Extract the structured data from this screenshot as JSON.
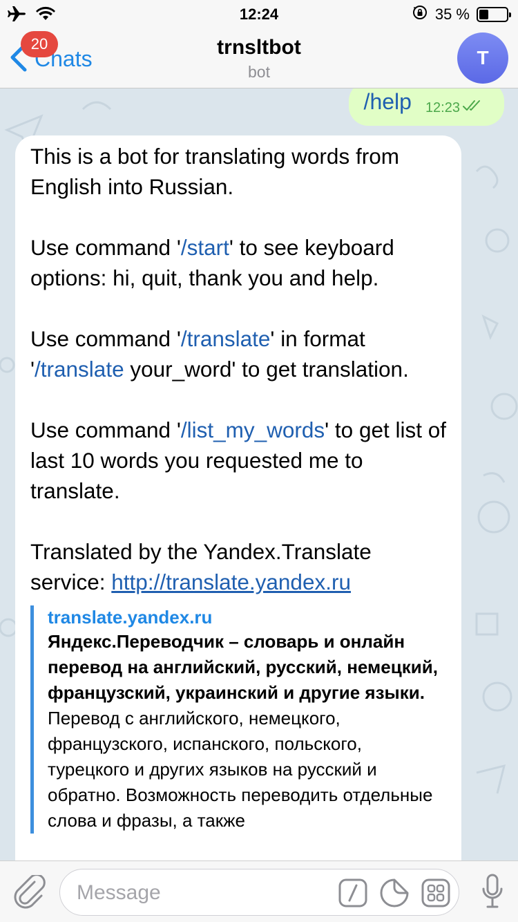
{
  "status_bar": {
    "time": "12:24",
    "battery_percent": "35 %",
    "battery_level": 0.35,
    "icons": [
      "airplane-icon",
      "wifi-icon",
      "rotation-lock-icon",
      "battery-icon"
    ]
  },
  "nav": {
    "back_label": "Chats",
    "unread_badge": "20",
    "title": "trnsltbot",
    "subtitle": "bot",
    "avatar_letter": "T"
  },
  "outgoing": {
    "text": "/help",
    "time": "12:23"
  },
  "incoming": {
    "p1": "This is a bot for translating words from English into Russian.",
    "p2_pre": "Use command '",
    "p2_cmd": "/start",
    "p2_post": "' to see keyboard options: hi, quit, thank you and help.",
    "p3_pre": "Use command '",
    "p3_cmd": "/translate",
    "p3_mid": "' in format '",
    "p3_cmd2": "/translate",
    "p3_post": " your_word' to get translation.",
    "p4_pre": "Use command '",
    "p4_cmd": "/list_my_words",
    "p4_post": "' to get list of last 10 words you requested me to translate.",
    "p5_pre": "Translated by the Yandex.Translate service: ",
    "p5_link": "http://translate.yandex.ru"
  },
  "preview": {
    "site": "translate.yandex.ru",
    "title": "Яндекс.Переводчик – словарь и онлайн перевод на английский, русский, немецкий, французский, украинский и другие языки.",
    "description": "Перевод с английского, немецкого, французского, испанского, польского, турецкого и других языков на русский и обратно. Возможность переводить отдельные слова и фразы, а также"
  },
  "input": {
    "placeholder": "Message"
  },
  "colors": {
    "accent": "#1f88e5",
    "outgoing_bubble": "#e1fec6",
    "badge": "#e5483f",
    "preview_bar": "#3d8fde"
  }
}
